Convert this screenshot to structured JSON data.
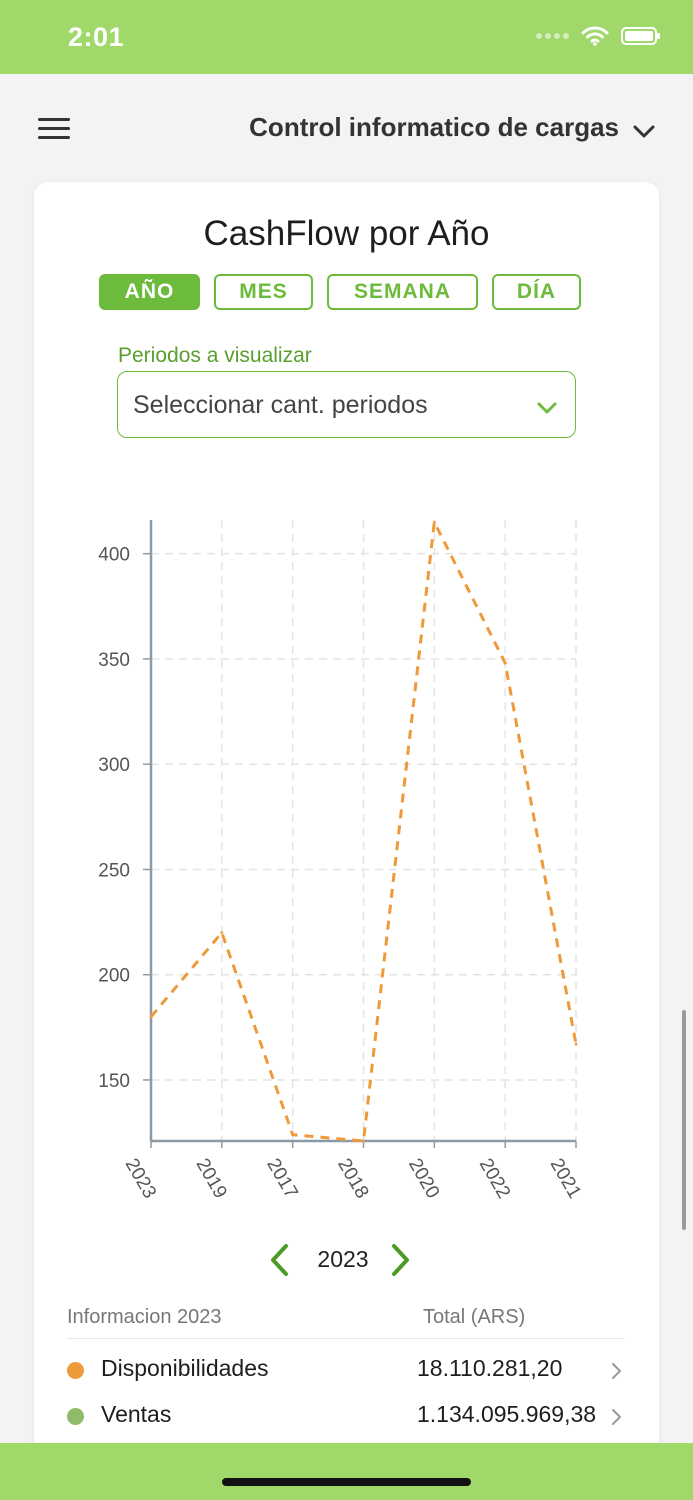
{
  "status": {
    "time": "2:01"
  },
  "header": {
    "title": "Control informatico de cargas"
  },
  "card": {
    "title": "CashFlow por Año",
    "tabs": [
      {
        "label": "AÑO",
        "active": true
      },
      {
        "label": "MES",
        "active": false
      },
      {
        "label": "SEMANA",
        "active": false
      },
      {
        "label": "DÍA",
        "active": false
      }
    ],
    "period_label": "Periodos a visualizar",
    "period_placeholder": "Seleccionar cant. periodos"
  },
  "chart_data": {
    "type": "line",
    "categories": [
      "2023",
      "2019",
      "2017",
      "2018",
      "2020",
      "2022",
      "2021"
    ],
    "series": [
      {
        "values": [
          180,
          220,
          124,
          121,
          415,
          348,
          167
        ],
        "color": "#ef9a3a",
        "style": "dashed"
      }
    ],
    "ylim": [
      121,
      416
    ],
    "yticks": [
      150,
      200,
      250,
      300,
      350,
      400
    ],
    "grid": true,
    "tick_rotation_x": 60
  },
  "year_nav": {
    "year": "2023"
  },
  "info": {
    "title": "Informacion 2023",
    "total_header": "Total (ARS)",
    "rows": [
      {
        "label": "Disponibilidades",
        "value": "18.110.281,20",
        "color": "#ef9a3a"
      },
      {
        "label": "Ventas",
        "value": "1.134.095.969,38",
        "color": "#8fbb6a"
      }
    ]
  },
  "colors": {
    "accent": "#6cbb3c",
    "bar": "#a0d86a",
    "line": "#ef9a3a"
  },
  "icons": {
    "menu": "hamburger-icon",
    "header_chevron": "chevron-down-icon",
    "select_chevron": "chevron-down-icon",
    "prev": "chevron-left-icon",
    "next": "chevron-right-icon",
    "row_chevron": "chevron-right-icon"
  }
}
